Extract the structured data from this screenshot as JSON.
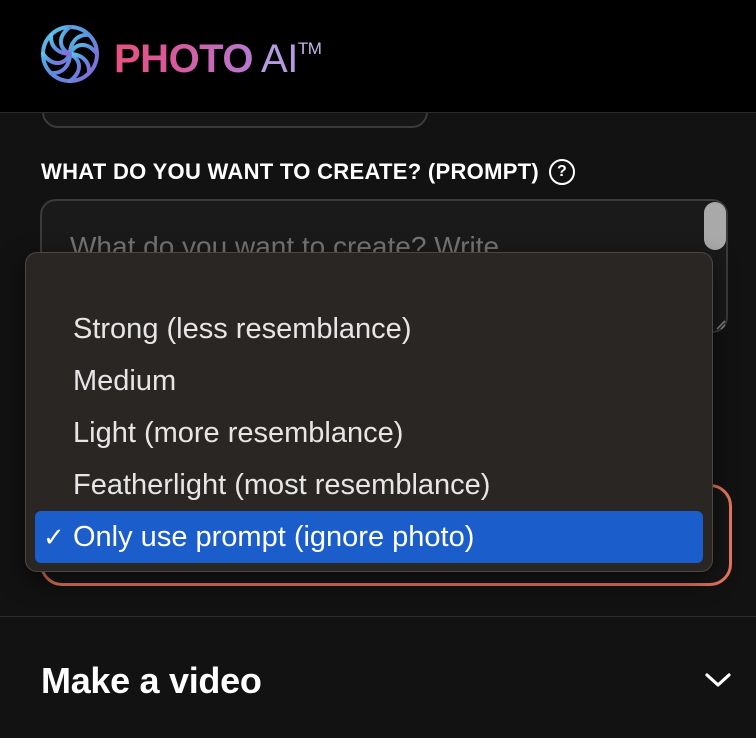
{
  "header": {
    "logo_icon": "photo-ai-logo-icon",
    "logo_word_1": "PHOTO",
    "logo_word_2": "AI",
    "logo_tm": "TM"
  },
  "prompt": {
    "label": "WHAT DO YOU WANT TO CREATE? (PROMPT)",
    "help_icon_glyph": "?",
    "placeholder": "What do you want to create? Write..."
  },
  "dropdown": {
    "options": [
      {
        "label": "Strong (less resemblance)",
        "selected": false
      },
      {
        "label": "Medium",
        "selected": false
      },
      {
        "label": "Light (more resemblance)",
        "selected": false
      },
      {
        "label": "Featherlight (most resemblance)",
        "selected": false
      },
      {
        "label": "Only use prompt (ignore photo)",
        "selected": true
      }
    ],
    "check_glyph": "✓",
    "selected_color": "#1b5ecb"
  },
  "video_section": {
    "title": "Make a video",
    "chevron_icon": "chevron-down-icon"
  },
  "colors": {
    "accent_outline": "#e7775e",
    "logo_gradient_start": "#e6527f",
    "logo_gradient_end": "#b57ad0"
  }
}
